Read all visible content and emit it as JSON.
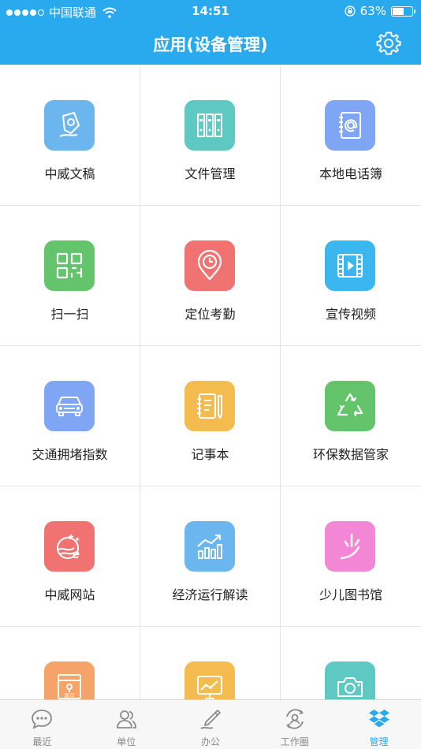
{
  "status_bar": {
    "carrier": "中国联通",
    "time": "14:51",
    "battery_text": "63%",
    "battery_level": 0.63
  },
  "nav": {
    "title": "应用(设备管理)",
    "settings_icon": "gear-icon"
  },
  "apps": [
    {
      "label": "中威文稿",
      "color": "#6cb6ef",
      "icon": "pen-document-icon"
    },
    {
      "label": "文件管理",
      "color": "#5ec9c2",
      "icon": "binders-icon"
    },
    {
      "label": "本地电话簿",
      "color": "#7fa6f5",
      "icon": "address-book-icon"
    },
    {
      "label": "扫一扫",
      "color": "#63c46b",
      "icon": "qr-scan-icon"
    },
    {
      "label": "定位考勤",
      "color": "#f07271",
      "icon": "location-clock-icon"
    },
    {
      "label": "宣传视频",
      "color": "#3cb6ef",
      "icon": "video-icon"
    },
    {
      "label": "交通拥堵指数",
      "color": "#7fa6f5",
      "icon": "car-icon"
    },
    {
      "label": "记事本",
      "color": "#f4bc4e",
      "icon": "notebook-icon"
    },
    {
      "label": "环保数据管家",
      "color": "#63c46b",
      "icon": "recycle-icon"
    },
    {
      "label": "中威网站",
      "color": "#f07271",
      "icon": "website-icon"
    },
    {
      "label": "经济运行解读",
      "color": "#6cb6ef",
      "icon": "trend-chart-icon"
    },
    {
      "label": "少儿图书馆",
      "color": "#f387d6",
      "icon": "kids-library-icon"
    },
    {
      "label": "",
      "color": "#f6a36a",
      "icon": "project-folder-icon",
      "badge": "项目"
    },
    {
      "label": "",
      "color": "#f4bc4e",
      "icon": "presentation-chart-icon"
    },
    {
      "label": "",
      "color": "#5ec9c2",
      "icon": "camera-icon"
    }
  ],
  "tabs": [
    {
      "label": "最近",
      "icon": "chat-bubble-icon",
      "active": false
    },
    {
      "label": "单位",
      "icon": "contacts-icon",
      "active": false
    },
    {
      "label": "办公",
      "icon": "office-pen-icon",
      "active": false
    },
    {
      "label": "工作圈",
      "icon": "work-circle-icon",
      "active": false
    },
    {
      "label": "管理",
      "icon": "dropbox-icon",
      "active": true
    }
  ],
  "colors": {
    "accent": "#29a9ee"
  }
}
